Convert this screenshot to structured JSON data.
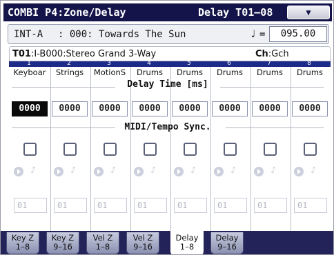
{
  "titlebar": {
    "mode": "COMBI P4:Zone/Delay",
    "page": "Delay T01–08",
    "menu_icon": "chevron-down-icon",
    "menu_glyph": "▼"
  },
  "combi": {
    "bank": "INT-A",
    "number_name": ": 000: Towards The Sun",
    "tempo_note": "♩",
    "tempo_eq": "=",
    "tempo": "095.00"
  },
  "timbre": {
    "id": "T01",
    "program": ":I-B000:Stereo Grand 3-Way",
    "ch_label": "Ch",
    "ch_value": ":Gch"
  },
  "columns": [
    {
      "num": "1",
      "program": "Keyboar",
      "delay": "0000",
      "channel": "01"
    },
    {
      "num": "2",
      "program": "Strings",
      "delay": "0000",
      "channel": "01"
    },
    {
      "num": "3",
      "program": "MotionS",
      "delay": "0000",
      "channel": "01"
    },
    {
      "num": "4",
      "program": "Drums",
      "delay": "0000",
      "channel": "01"
    },
    {
      "num": "5",
      "program": "Drums",
      "delay": "0000",
      "channel": "01"
    },
    {
      "num": "6",
      "program": "Drums",
      "delay": "0000",
      "channel": "01"
    },
    {
      "num": "7",
      "program": "Drums",
      "delay": "0000",
      "channel": "01"
    },
    {
      "num": "8",
      "program": "Drums",
      "delay": "0000",
      "channel": "01"
    }
  ],
  "sections": {
    "delay_time": "Delay Time [ms]",
    "midi_sync": "MIDI/Tempo Sync."
  },
  "tabs": [
    {
      "line1": "Key Z",
      "line2": "1–8"
    },
    {
      "line1": "Key Z",
      "line2": "9–16"
    },
    {
      "line1": "Vel Z",
      "line2": "1–8"
    },
    {
      "line1": "Vel Z",
      "line2": "9–16"
    },
    {
      "line1": "Delay",
      "line2": "1–8",
      "active": true
    },
    {
      "line1": "Delay",
      "line2": "9–16"
    }
  ],
  "note_glyph": "♪"
}
